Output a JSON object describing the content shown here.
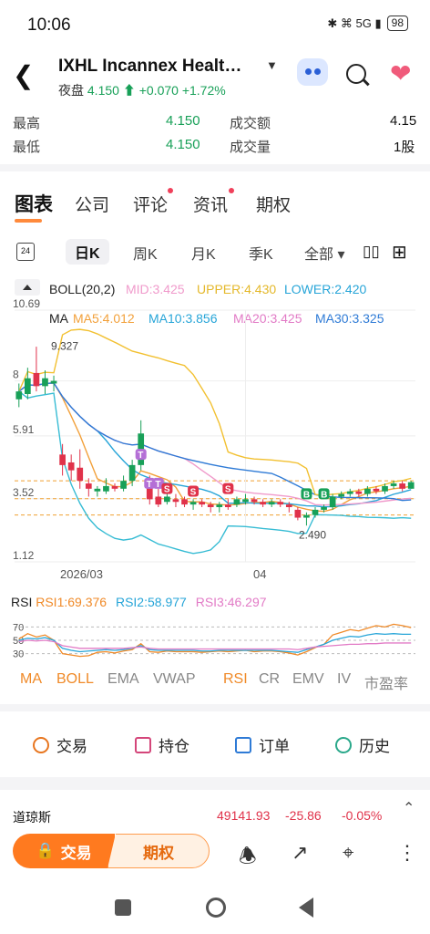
{
  "status": {
    "time": "10:06",
    "icons": "✱ ⌘ 5G ▮",
    "battery": "98"
  },
  "header": {
    "title": "IXHL  Incannex Healt…",
    "night_label": "夜盘",
    "night_price": "4.150",
    "night_arrow": "⬆",
    "night_change": "+0.070",
    "night_pct": "+1.72%"
  },
  "stats": {
    "high_label": "最高",
    "high_value": "4.150",
    "low_label": "最低",
    "low_value": "4.150",
    "turnover_label": "成交额",
    "turnover_value": "4.15",
    "volume_label": "成交量",
    "volume_value": "1股"
  },
  "tabs": [
    "图表",
    "公司",
    "评论",
    "资讯",
    "期权"
  ],
  "periods": {
    "cal": "24",
    "items": [
      "日K",
      "周K",
      "月K",
      "季K",
      "全部 ▾"
    ]
  },
  "boll_legend": {
    "name": "BOLL(20,2)",
    "mid": "MID:3.425",
    "upper": "UPPER:4.430",
    "lower": "LOWER:2.420"
  },
  "ma_legend": {
    "name": "MA",
    "ma5": "MA5:4.012",
    "ma10": "MA10:3.856",
    "ma20": "MA20:3.425",
    "ma30": "MA30:3.325"
  },
  "chart_data": {
    "type": "candlestick",
    "y_ticks": [
      "10.69",
      "8",
      "5.91",
      "3.52",
      "1.12"
    ],
    "x_ticks": [
      "2026/03",
      "04"
    ],
    "annotations": [
      "9.327",
      "2.490"
    ],
    "markers": [
      "T",
      "T",
      "T",
      "S",
      "S",
      "S",
      "B",
      "B"
    ],
    "ylim": [
      1.12,
      10.69
    ],
    "candles": [
      {
        "o": 7.3,
        "c": 7.6,
        "h": 7.9,
        "l": 7.0
      },
      {
        "o": 7.5,
        "c": 8.1,
        "h": 8.5,
        "l": 7.3
      },
      {
        "o": 8.3,
        "c": 7.8,
        "h": 9.3,
        "l": 7.6
      },
      {
        "o": 7.8,
        "c": 8.1,
        "h": 8.4,
        "l": 7.5
      },
      {
        "o": 7.9,
        "c": 8.0,
        "h": 8.2,
        "l": 7.6
      },
      {
        "o": 5.2,
        "c": 4.8,
        "h": 5.6,
        "l": 4.4
      },
      {
        "o": 4.9,
        "c": 4.6,
        "h": 5.2,
        "l": 4.2
      },
      {
        "o": 4.7,
        "c": 4.2,
        "h": 5.4,
        "l": 3.9
      },
      {
        "o": 4.1,
        "c": 3.9,
        "h": 4.3,
        "l": 3.6
      },
      {
        "o": 3.8,
        "c": 3.9,
        "h": 4.0,
        "l": 3.6
      },
      {
        "o": 3.8,
        "c": 4.0,
        "h": 4.3,
        "l": 3.7
      },
      {
        "o": 4.0,
        "c": 3.9,
        "h": 4.1,
        "l": 3.8
      },
      {
        "o": 3.9,
        "c": 4.2,
        "h": 4.4,
        "l": 3.8
      },
      {
        "o": 4.2,
        "c": 4.8,
        "h": 5.0,
        "l": 4.0
      },
      {
        "o": 4.8,
        "c": 6.0,
        "h": 6.5,
        "l": 4.6
      },
      {
        "o": 4.2,
        "c": 3.5,
        "h": 4.4,
        "l": 3.3
      },
      {
        "o": 3.6,
        "c": 3.3,
        "h": 3.9,
        "l": 3.2
      },
      {
        "o": 3.4,
        "c": 3.6,
        "h": 3.8,
        "l": 3.3
      },
      {
        "o": 3.5,
        "c": 3.4,
        "h": 3.7,
        "l": 3.2
      },
      {
        "o": 3.5,
        "c": 3.3,
        "h": 3.6,
        "l": 3.2
      },
      {
        "o": 3.3,
        "c": 3.4,
        "h": 3.5,
        "l": 3.1
      },
      {
        "o": 3.4,
        "c": 3.3,
        "h": 3.5,
        "l": 3.2
      },
      {
        "o": 3.3,
        "c": 3.2,
        "h": 3.4,
        "l": 3.0
      },
      {
        "o": 3.2,
        "c": 3.3,
        "h": 3.4,
        "l": 3.0
      },
      {
        "o": 3.3,
        "c": 3.2,
        "h": 3.5,
        "l": 3.1
      },
      {
        "o": 3.3,
        "c": 3.5,
        "h": 3.6,
        "l": 3.2
      },
      {
        "o": 3.4,
        "c": 3.5,
        "h": 3.7,
        "l": 3.3
      },
      {
        "o": 3.5,
        "c": 3.4,
        "h": 3.6,
        "l": 3.3
      },
      {
        "o": 3.4,
        "c": 3.3,
        "h": 3.5,
        "l": 3.2
      },
      {
        "o": 3.3,
        "c": 3.4,
        "h": 3.5,
        "l": 3.2
      },
      {
        "o": 3.4,
        "c": 3.3,
        "h": 3.5,
        "l": 3.2
      },
      {
        "o": 3.3,
        "c": 3.2,
        "h": 3.4,
        "l": 3.0
      },
      {
        "o": 3.1,
        "c": 2.8,
        "h": 3.2,
        "l": 2.7
      },
      {
        "o": 2.8,
        "c": 2.9,
        "h": 3.0,
        "l": 2.5
      },
      {
        "o": 2.9,
        "c": 3.1,
        "h": 3.2,
        "l": 2.8
      },
      {
        "o": 3.1,
        "c": 3.2,
        "h": 3.3,
        "l": 3.0
      },
      {
        "o": 3.2,
        "c": 3.6,
        "h": 3.7,
        "l": 3.1
      },
      {
        "o": 3.6,
        "c": 3.7,
        "h": 3.8,
        "l": 3.5
      },
      {
        "o": 3.7,
        "c": 3.8,
        "h": 3.9,
        "l": 3.6
      },
      {
        "o": 3.8,
        "c": 3.7,
        "h": 3.9,
        "l": 3.6
      },
      {
        "o": 3.7,
        "c": 3.9,
        "h": 4.0,
        "l": 3.6
      },
      {
        "o": 3.9,
        "c": 3.8,
        "h": 4.0,
        "l": 3.7
      },
      {
        "o": 3.8,
        "c": 4.0,
        "h": 4.1,
        "l": 3.7
      },
      {
        "o": 4.0,
        "c": 4.1,
        "h": 4.2,
        "l": 3.9
      },
      {
        "o": 4.1,
        "c": 3.9,
        "h": 4.2,
        "l": 3.8
      },
      {
        "o": 3.9,
        "c": 4.15,
        "h": 4.2,
        "l": 3.9
      }
    ],
    "series": [
      {
        "name": "MA5",
        "color": "#f2a03a"
      },
      {
        "name": "MA10",
        "color": "#27a5d8"
      },
      {
        "name": "MA20",
        "color": "#f09acb"
      },
      {
        "name": "MA30",
        "color": "#2f7bd6"
      },
      {
        "name": "UPPER",
        "color": "#f2c030"
      },
      {
        "name": "LOWER",
        "color": "#37bcd4"
      }
    ],
    "dashed_levels": [
      4.2,
      3.52,
      2.9
    ]
  },
  "rsi": {
    "rsi1": "RSI1:69.376",
    "rsi2": "RSI2:58.977",
    "rsi3": "RSI3:46.297",
    "y_ticks": [
      "70",
      "50",
      "30"
    ],
    "rsi1_values": [
      52,
      60,
      55,
      58,
      50,
      30,
      28,
      26,
      27,
      32,
      33,
      31,
      34,
      36,
      45,
      33,
      32,
      34,
      33,
      33,
      33,
      32,
      33,
      34,
      33,
      34,
      35,
      33,
      34,
      34,
      33,
      31,
      28,
      33,
      39,
      44,
      58,
      62,
      66,
      64,
      68,
      72,
      70,
      74,
      72,
      69
    ],
    "rsi2_values": [
      50,
      53,
      52,
      54,
      50,
      38,
      35,
      33,
      34,
      35,
      36,
      35,
      36,
      38,
      42,
      36,
      35,
      35,
      35,
      35,
      35,
      34,
      34,
      35,
      35,
      35,
      35,
      35,
      35,
      35,
      34,
      33,
      32,
      36,
      40,
      44,
      50,
      53,
      56,
      55,
      58,
      60,
      59,
      60,
      59,
      59
    ],
    "rsi3_values": [
      48,
      50,
      49,
      50,
      48,
      42,
      40,
      38,
      38,
      38,
      38,
      38,
      38,
      39,
      40,
      38,
      37,
      37,
      37,
      37,
      37,
      37,
      37,
      37,
      37,
      37,
      37,
      37,
      37,
      37,
      37,
      37,
      36,
      38,
      40,
      41,
      42,
      43,
      44,
      44,
      45,
      45,
      46,
      46,
      46,
      46
    ]
  },
  "indicators": [
    "MA",
    "BOLL",
    "EMA",
    "VWAP",
    "RSI",
    "CR",
    "EMV",
    "IV",
    "市盈率"
  ],
  "actions": [
    "交易",
    "持仓",
    "订单",
    "历史"
  ],
  "market_ticker": {
    "name": "道琼斯",
    "value": "49141.93",
    "change": "-25.86",
    "pct": "-0.05%"
  },
  "bottom": {
    "trade": "交易",
    "option": "期权"
  }
}
